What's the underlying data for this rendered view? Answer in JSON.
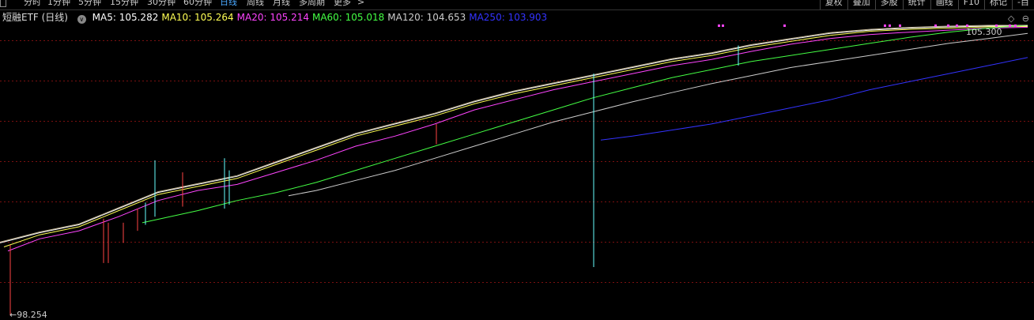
{
  "toolbar": {
    "timeframes": [
      "分时",
      "1分钟",
      "5分钟",
      "15分钟",
      "30分钟",
      "60分钟",
      "日线",
      "周线",
      "月线",
      "多周期",
      "更多"
    ],
    "active": "日线",
    "more_arrow": ">",
    "right_buttons": [
      "复权",
      "叠加",
      "多股",
      "统计",
      "画线",
      "F10",
      "标记",
      "-目"
    ]
  },
  "header": {
    "security": "短融ETF (日线)",
    "dropdown_icon": "chevron-down-icon",
    "ma": [
      {
        "label": "MA5: 105.282",
        "color": "#ffffff"
      },
      {
        "label": "MA10: 105.264",
        "color": "#ffff55"
      },
      {
        "label": "MA20: 105.214",
        "color": "#ff44ff"
      },
      {
        "label": "MA60: 105.018",
        "color": "#44ff44"
      },
      {
        "label": "MA120: 104.653",
        "color": "#cccccc"
      },
      {
        "label": "MA250: 103.903",
        "color": "#3333ff"
      }
    ]
  },
  "right_icons": [
    "◇",
    "⊖"
  ],
  "chart_data": {
    "type": "line",
    "subtype": "candlestick-with-moving-averages",
    "ylim": [
      98.254,
      105.43
    ],
    "price_labels": {
      "high": "105.300",
      "low": "98.254"
    },
    "series": [
      {
        "name": "MA5",
        "color": "#ffffff",
        "x": [
          0,
          50,
          100,
          150,
          200,
          250,
          300,
          350,
          400,
          450,
          500,
          550,
          600,
          650,
          700,
          750,
          800,
          850,
          900,
          950,
          1000,
          1050,
          1100,
          1150,
          1200,
          1250,
          1300
        ],
        "y": [
          100.05,
          100.3,
          100.5,
          100.9,
          101.3,
          101.5,
          101.7,
          102.05,
          102.4,
          102.75,
          103.0,
          103.25,
          103.55,
          103.8,
          104.0,
          104.2,
          104.4,
          104.6,
          104.75,
          104.95,
          105.1,
          105.25,
          105.33,
          105.38,
          105.41,
          105.43,
          105.43
        ]
      },
      {
        "name": "MA10",
        "color": "#ffff55",
        "x": [
          5,
          50,
          100,
          150,
          200,
          250,
          300,
          350,
          400,
          450,
          500,
          550,
          600,
          650,
          700,
          750,
          800,
          850,
          900,
          950,
          1000,
          1050,
          1100,
          1150,
          1200,
          1250,
          1300
        ],
        "y": [
          99.95,
          100.25,
          100.45,
          100.85,
          101.25,
          101.45,
          101.65,
          102.0,
          102.35,
          102.7,
          102.95,
          103.2,
          103.5,
          103.75,
          103.95,
          104.15,
          104.35,
          104.55,
          104.7,
          104.9,
          105.05,
          105.2,
          105.3,
          105.35,
          105.38,
          105.41,
          105.42
        ]
      },
      {
        "name": "MA20",
        "color": "#ff44ff",
        "x": [
          10,
          50,
          100,
          150,
          200,
          250,
          300,
          350,
          400,
          450,
          500,
          550,
          600,
          650,
          700,
          750,
          800,
          850,
          900,
          950,
          1000,
          1050,
          1100,
          1150,
          1200,
          1250,
          1300
        ],
        "y": [
          99.85,
          100.15,
          100.35,
          100.7,
          101.1,
          101.35,
          101.5,
          101.8,
          102.1,
          102.45,
          102.7,
          103.0,
          103.35,
          103.6,
          103.85,
          104.05,
          104.25,
          104.45,
          104.6,
          104.8,
          104.98,
          105.12,
          105.22,
          105.28,
          105.33,
          105.38,
          105.4
        ]
      },
      {
        "name": "MA60",
        "color": "#44ff44",
        "x": [
          180,
          250,
          300,
          350,
          400,
          450,
          500,
          550,
          600,
          650,
          700,
          750,
          800,
          850,
          900,
          950,
          1000,
          1050,
          1100,
          1150,
          1200,
          1250,
          1300
        ],
        "y": [
          100.55,
          100.85,
          101.1,
          101.3,
          101.55,
          101.85,
          102.15,
          102.45,
          102.75,
          103.05,
          103.35,
          103.65,
          103.9,
          104.15,
          104.35,
          104.55,
          104.7,
          104.85,
          105.0,
          105.15,
          105.28,
          105.38,
          105.45
        ]
      },
      {
        "name": "MA120",
        "color": "#cccccc",
        "x": [
          365,
          400,
          450,
          500,
          550,
          600,
          650,
          700,
          750,
          800,
          850,
          900,
          950,
          1000,
          1050,
          1100,
          1150,
          1200,
          1250,
          1300
        ],
        "y": [
          101.22,
          101.35,
          101.6,
          101.85,
          102.15,
          102.45,
          102.75,
          103.05,
          103.3,
          103.55,
          103.78,
          104.0,
          104.2,
          104.4,
          104.55,
          104.7,
          104.85,
          105.0,
          105.12,
          105.25
        ]
      },
      {
        "name": "MA250",
        "color": "#3333ff",
        "x": [
          760,
          800,
          850,
          900,
          950,
          1000,
          1050,
          1100,
          1150,
          1200,
          1250,
          1300
        ],
        "y": [
          102.6,
          102.7,
          102.85,
          103.0,
          103.2,
          103.4,
          103.6,
          103.85,
          104.05,
          104.25,
          104.45,
          104.65
        ]
      }
    ],
    "spikes": [
      {
        "x": 13,
        "high": 100.0,
        "low": 98.25,
        "color": "#ff4444"
      },
      {
        "x": 131,
        "high": 100.65,
        "low": 99.55,
        "color": "#ff4444"
      },
      {
        "x": 137,
        "high": 100.55,
        "low": 99.55,
        "color": "#ff4444"
      },
      {
        "x": 156,
        "high": 100.55,
        "low": 100.05,
        "color": "#ff4444"
      },
      {
        "x": 174,
        "high": 100.9,
        "low": 100.35,
        "color": "#ff4444"
      },
      {
        "x": 184,
        "high": 101.05,
        "low": 100.5,
        "color": "#66ffff"
      },
      {
        "x": 196,
        "high": 102.1,
        "low": 100.7,
        "color": "#66ffff"
      },
      {
        "x": 231,
        "high": 101.8,
        "low": 100.95,
        "color": "#ff4444"
      },
      {
        "x": 284,
        "high": 102.15,
        "low": 100.9,
        "color": "#66ffff"
      },
      {
        "x": 290,
        "high": 101.85,
        "low": 101.0,
        "color": "#66ffff"
      },
      {
        "x": 552,
        "high": 103.0,
        "low": 102.5,
        "color": "#ff4444"
      },
      {
        "x": 751,
        "high": 104.25,
        "low": 99.45,
        "color": "#66ffff"
      },
      {
        "x": 934,
        "high": 104.95,
        "low": 104.45,
        "color": "#66ffff"
      }
    ],
    "markers": [
      908,
      913,
      991,
      1118,
      1124,
      1137,
      1182,
      1198,
      1209,
      1222,
      1259,
      1276,
      1283
    ]
  }
}
